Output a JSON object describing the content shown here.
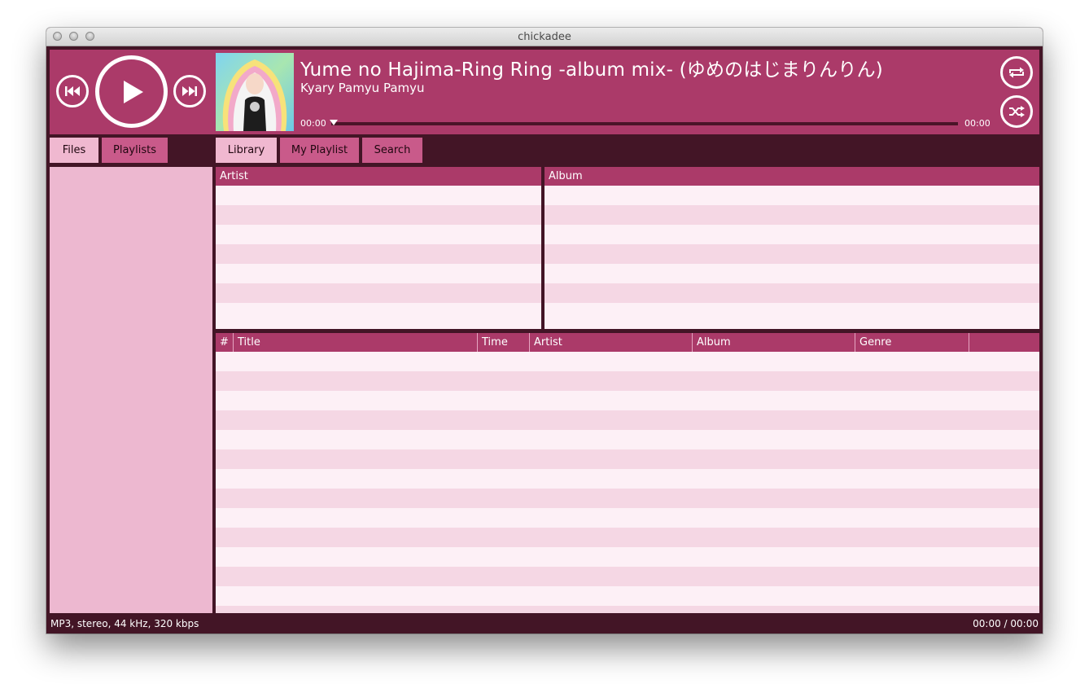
{
  "window": {
    "title": "chickadee"
  },
  "player": {
    "track_title": "Yume no Hajima-Ring Ring -album mix- (ゆめのはじまりんりん)",
    "artist": "Kyary Pamyu Pamyu",
    "time_elapsed": "00:00",
    "time_total": "00:00",
    "progress": 0,
    "icons": {
      "prev": "previous-track-icon",
      "play": "play-icon",
      "next": "next-track-icon",
      "repeat": "repeat-icon",
      "shuffle": "shuffle-icon"
    }
  },
  "left_tabs": [
    {
      "label": "Files",
      "active": true
    },
    {
      "label": "Playlists",
      "active": false
    }
  ],
  "main_tabs": [
    {
      "label": "Library",
      "active": true
    },
    {
      "label": "My Playlist",
      "active": false
    },
    {
      "label": "Search",
      "active": false
    }
  ],
  "artist_pane": {
    "header": "Artist"
  },
  "album_pane": {
    "header": "Album"
  },
  "tracks_table": {
    "columns": [
      "#",
      "Title",
      "Time",
      "Artist",
      "Album",
      "Genre"
    ]
  },
  "status": {
    "format": "MP3, stereo, 44 kHz, 320 kbps",
    "position": "00:00 / 00:00"
  },
  "colors": {
    "accent": "#ab3a69",
    "dark": "#431526",
    "tab_active": "#f0b8d0",
    "tab_inactive": "#c95a8a",
    "row_light": "#fdf0f6",
    "row_dark": "#f5d7e4"
  }
}
